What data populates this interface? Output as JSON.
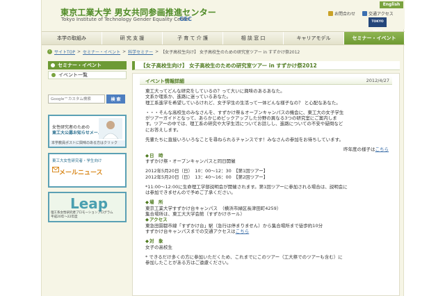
{
  "header": {
    "logo_jp": "東京工業大学 男女共同参画推進センター",
    "logo_en": "Tokyo Institute of Technology    Gender Equality Center",
    "logo_gec": "GEC",
    "lang_button": "English",
    "util_links": [
      {
        "label": "お問合わせ",
        "icon": "mail-icon"
      },
      {
        "label": "交通アクセス",
        "icon": "map-icon"
      }
    ],
    "tokyotech": "TOKYO TECH"
  },
  "nav": {
    "items": [
      "本学の取組み",
      "研 究 支 援",
      "子 育 て 介 護",
      "相 談 窓 口",
      "キャリアモデル",
      "セミナー・イベント"
    ],
    "active_index": 5
  },
  "breadcrumb": {
    "items": [
      "サイトTOP",
      "セミナー・イベント",
      "科学セミナー"
    ],
    "current": "【女子高校生向け】 女子高校生のための研究室ツアー in すずかけ祭2012"
  },
  "sidebar": {
    "heading": "セミナー・イベント",
    "link": "イベント一覧",
    "search_placeholder": "Google™カスタム検索",
    "search_button": "検 索",
    "banner1": {
      "line1": "女性研究者のための",
      "line2": "東工大公募お知らせメール",
      "strip": "本学教員ポストに興味のある方はクリック"
    },
    "banner2": {
      "line1": "東工大女性研究者・学生向け",
      "line2": "メールニュース"
    },
    "banner3": {
      "logo": "Leap",
      "line1": "理工系女性研究者プロモーションプログラム",
      "line2": "平成20年〜22年度"
    }
  },
  "main": {
    "title": "【女子高校生向け】 女子高校生のための研究室ツアー in すずかけ祭2012",
    "section_title": "イベント情報詳細",
    "date": "2012/4/27",
    "intro": [
      "東工大ってどんな研究をしているの？って大いに興味のあるあなた。",
      "文系か理系か、進路に迷っているあなた。",
      "理工系進学を希望しているけれど、女子学生の生活って一体どんな様子なの？ と心配なあなた。"
    ],
    "para2": [
      "・・・そんな高校生のみなさんを、すずかけ祭＆オープンキャンパスの機会に、東工大の女子学生",
      "がツアーガイドとなって、あらかじめピックアップした分野の異なる3つの研究室にご案内しま",
      "す。ツアーの中では、理工系の研究や大学生活についてお話しし、進路についての不安や疑問など",
      "にお答えします。"
    ],
    "para3": "先輩たちに直接いろいろなことを尋ねられるチャンスです！みなさんの参加をお待ちしています。",
    "last_year_text": "昨年度の様子は",
    "last_year_link": "こちら",
    "schedule_head": "日　時",
    "schedule_sub": "すずかけ祭・オープンキャンパスと同日開催",
    "schedule_rows": [
      "2012年5月20日（日）　10：00〜12：30　【第1回ツアー】",
      "2012年5月20日（日）　13：40〜16：00　【第2回ツアー】"
    ],
    "schedule_note": [
      "*11:00〜12:00に生命理工学部説明会が開催されます。第1回ツアーに参加される場合は、説明会に",
      "は参加できませんので予めご了承ください。"
    ],
    "place_head": "場　所",
    "place_rows": [
      "東京工業大学すずかけ台キャンパス　（横浜市緑区長津田町4259）",
      "集合場所は、東工大大学会館（すずかけホール）"
    ],
    "access_head": "アクセス",
    "access_rows": [
      "東急田園都市線「すずかけ台」駅（急行は停まりません）から集合場所まで徒歩約10分",
      "すずかけ台キャンパスまでの交通アクセスは"
    ],
    "access_link": "こちら",
    "target_head": "対　象",
    "target_row": "女子の高校生",
    "footer_note": [
      "* できるだけ多くの方に参加いただくため、これまでにこのツアー（工大祭でのツアーも含む）に",
      "参加したことがある方はご遠慮ください。"
    ],
    "accent_color": "#6d9a35"
  }
}
